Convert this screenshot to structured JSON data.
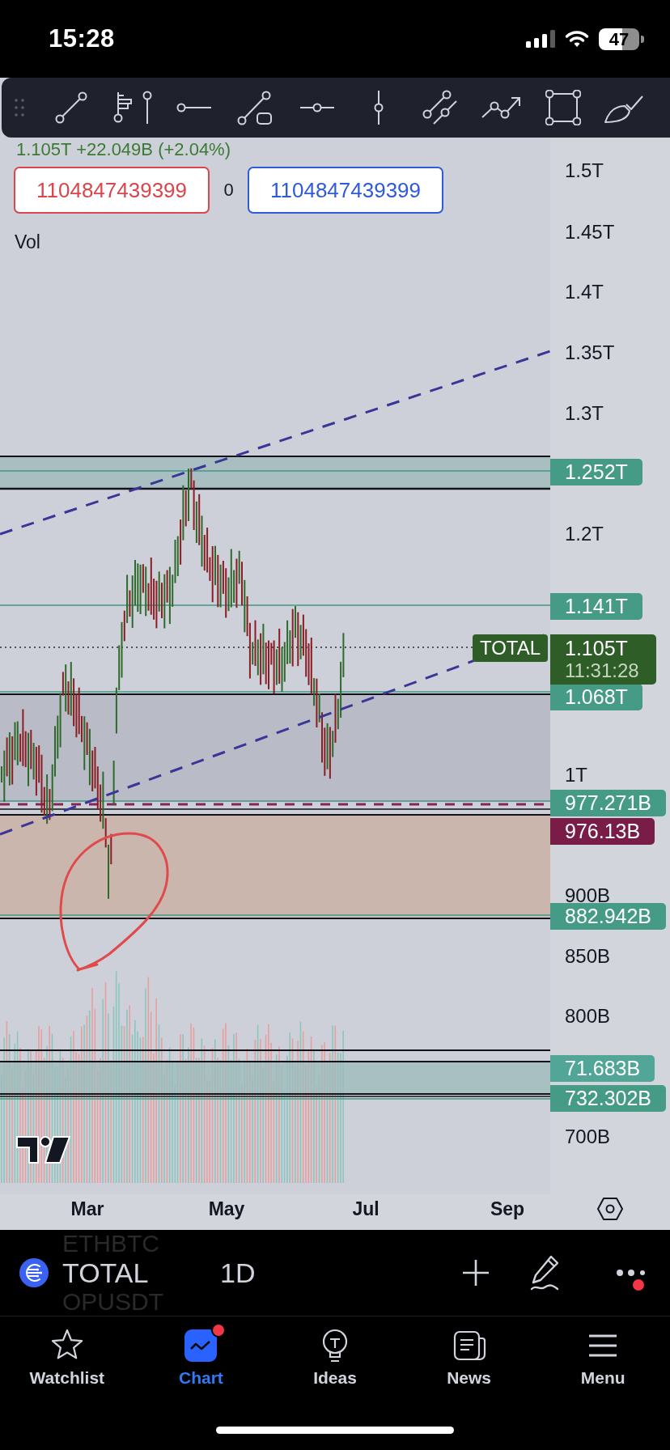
{
  "status_bar": {
    "time": "15:28",
    "battery": "47"
  },
  "chart": {
    "price_change": "1.105T +22.049B (+2.04%)",
    "quote_buttons": [
      {
        "value": "1104847439399",
        "color": "#d9464b"
      },
      {
        "value": "1104847439399",
        "color": "#2f5bd9"
      }
    ],
    "spread": "0",
    "volume_label": "Vol",
    "price_axis": [
      "1.5T",
      "1.45T",
      "1.4T",
      "1.35T",
      "1.3T",
      "1.2T",
      "1T",
      "900B",
      "850B",
      "800B",
      "700B"
    ],
    "level_labels": [
      {
        "text": "1.252T",
        "color": "#459b86"
      },
      {
        "text": "1.141T",
        "color": "#459b86"
      },
      {
        "text": "1.068T",
        "color": "#459b86"
      },
      {
        "text": "977.271B",
        "color": "#459b86"
      },
      {
        "text": "976.13B",
        "color": "#7a1c48"
      },
      {
        "text": "882.942B",
        "color": "#459b86"
      },
      {
        "text": "71.683B",
        "color": "#52a697"
      },
      {
        "text": "732.302B",
        "color": "#459b86"
      }
    ],
    "symbol_tag": "TOTAL",
    "last_price": "1.105T",
    "countdown": "11:31:28",
    "time_axis": [
      "Mar",
      "May",
      "Jul",
      "Sep"
    ]
  },
  "symbol_bar": {
    "previous_symbol": "ETHBTC",
    "symbol": "TOTAL",
    "next_symbol": "OPUSDT",
    "interval": "1D",
    "more_alert": true
  },
  "tab_bar": {
    "tabs": [
      {
        "label": "Watchlist",
        "selected": false,
        "alert": false
      },
      {
        "label": "Chart",
        "selected": true,
        "alert": true
      },
      {
        "label": "Ideas",
        "selected": false,
        "alert": false
      },
      {
        "label": "News",
        "selected": false,
        "alert": false
      },
      {
        "label": "Menu",
        "selected": false,
        "alert": false
      }
    ]
  }
}
